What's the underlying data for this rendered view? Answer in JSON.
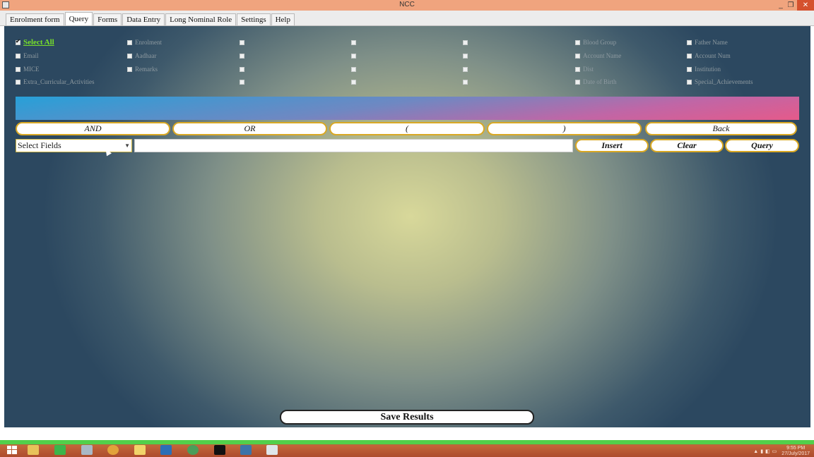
{
  "window": {
    "title": "NCC",
    "controls": [
      "_",
      "❐",
      "✕"
    ]
  },
  "tabs": [
    {
      "label": "Enrolment form",
      "active": false
    },
    {
      "label": "Query",
      "active": true
    },
    {
      "label": "Forms",
      "active": false
    },
    {
      "label": "Data Entry",
      "active": false
    },
    {
      "label": "Long Nominal Role",
      "active": false
    },
    {
      "label": "Settings",
      "active": false
    },
    {
      "label": "Help",
      "active": false
    }
  ],
  "fields": {
    "select_all": "Select All",
    "enrolment": "Enrolment",
    "blood_group": "Blood Group",
    "father_name": "Father Name",
    "email": "Email",
    "aadhaar": "Aadhaar",
    "account_name": "Account Name",
    "account_num": "Account Num",
    "mice": "MICE",
    "remarks": "Remarks",
    "dist": "Dist",
    "institution": "Institution",
    "extra_curricular": "Extra_Curricular_Activities",
    "date_of_birth": "Date of Birth",
    "special_achievements": "Special_Achievements"
  },
  "operators": {
    "and": "AND",
    "or": "OR",
    "open_paren": "(",
    "close_paren": ")",
    "back": "Back"
  },
  "query": {
    "select_value": "Select Fields",
    "input_value": "",
    "insert": "Insert",
    "clear": "Clear",
    "query": "Query"
  },
  "save_results": "Save Results",
  "taskbar": {
    "time": "9:55 PM",
    "date": "27/July/2017"
  },
  "colors": {
    "titlebar": "#f0a47e",
    "close_button": "#d5512e",
    "select_all": "#78e02a",
    "button_border": "#d9a824",
    "taskbar_accent": "#52d04a"
  }
}
